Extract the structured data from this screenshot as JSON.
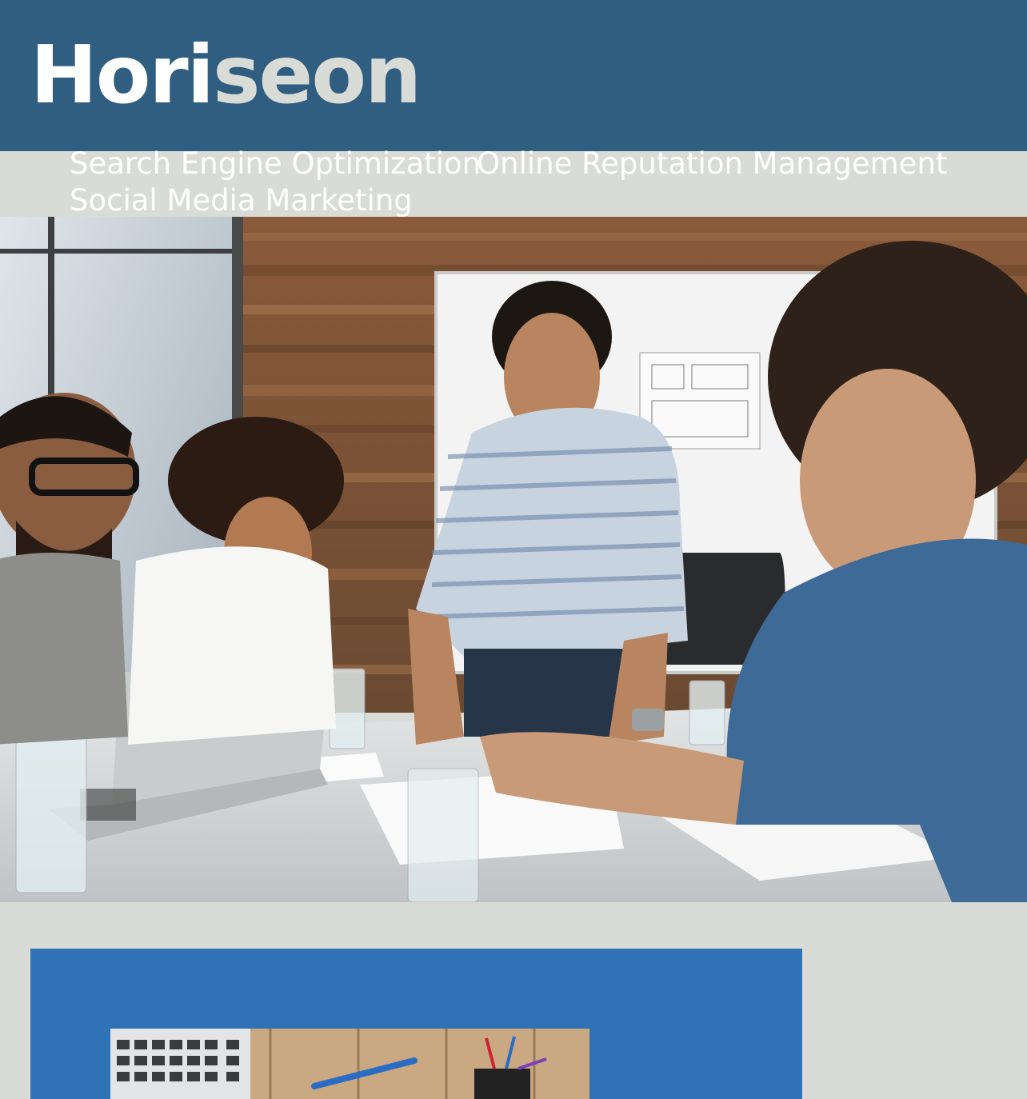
{
  "header": {
    "logo_primary": "Hori",
    "logo_secondary": "seon"
  },
  "nav": {
    "items": [
      {
        "label": "Search Engine Optimization"
      },
      {
        "label": "Online Reputation Management"
      },
      {
        "label": "Social Media Marketing"
      }
    ]
  },
  "colors": {
    "header_bg": "#2f5e80",
    "page_bg": "#d9dcd6",
    "panel_bg": "#2f72b5",
    "logo_text": "#ffffff",
    "logo_accent": "#d9dcd6"
  },
  "images": {
    "hero": "team-meeting-photo",
    "panel": "desk-workspace-photo"
  }
}
